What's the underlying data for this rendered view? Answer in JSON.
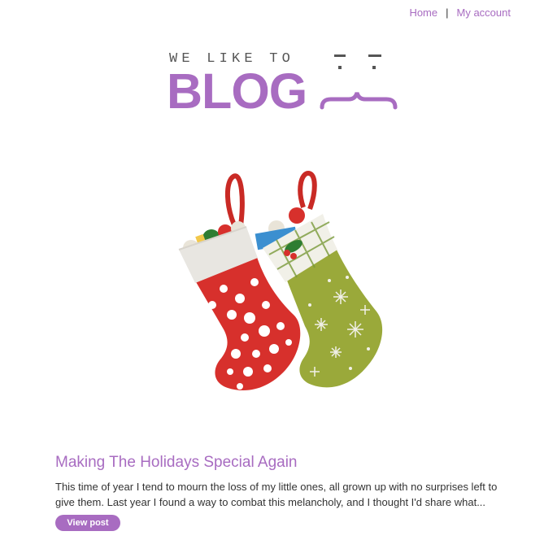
{
  "nav": {
    "home": "Home",
    "separator": "|",
    "account": "My account"
  },
  "logo": {
    "tagline": "WE LIKE TO",
    "word": "BLOG",
    "icon": "winking-face-icon"
  },
  "post": {
    "image_alt": "christmas-stockings-illustration",
    "title": "Making The Holidays Special Again",
    "excerpt": "This time of year I tend to mourn the loss of my little ones, all grown up with no surprises left to give them. Last year I found a way to combat this melancholy, and I thought I'd share what...",
    "button": "View post"
  },
  "colors": {
    "accent": "#a86cc1",
    "text": "#333333",
    "stocking_red": "#d7302c",
    "stocking_green": "#9aa93a"
  }
}
